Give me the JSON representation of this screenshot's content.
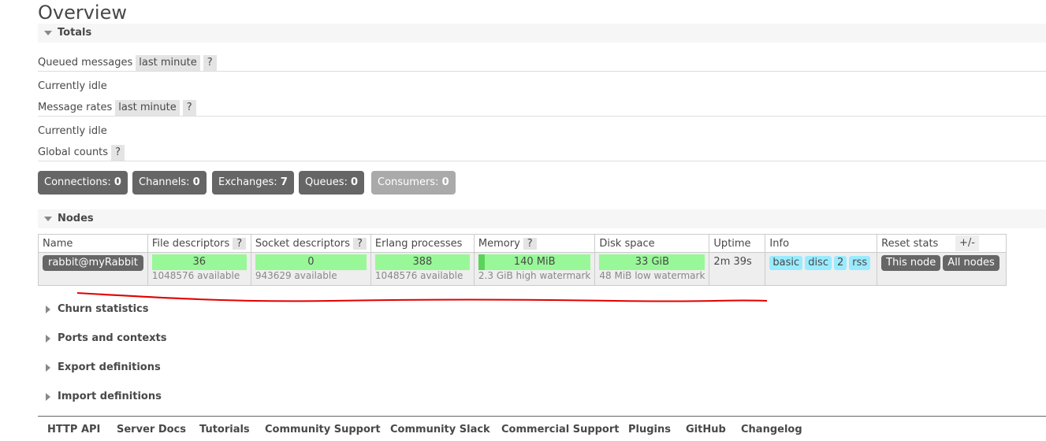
{
  "page": {
    "title": "Overview"
  },
  "totals": {
    "header": "Totals",
    "queued_label": "Queued messages",
    "queued_range": "last minute",
    "help": "?",
    "queued_status": "Currently idle",
    "rates_label": "Message rates",
    "rates_range": "last minute",
    "rates_status": "Currently idle",
    "global_label": "Global counts"
  },
  "counts": [
    {
      "label": "Connections:",
      "value": "0"
    },
    {
      "label": "Channels:",
      "value": "0"
    },
    {
      "label": "Exchanges:",
      "value": "7"
    },
    {
      "label": "Queues:",
      "value": "0"
    },
    {
      "label": "Consumers:",
      "value": "0"
    }
  ],
  "nodes": {
    "header": "Nodes",
    "columns": {
      "name": "Name",
      "file_descriptors": "File descriptors",
      "socket_descriptors": "Socket descriptors",
      "erlang_processes": "Erlang processes",
      "memory": "Memory",
      "disk_space": "Disk space",
      "uptime": "Uptime",
      "info": "Info",
      "reset_stats": "Reset stats"
    },
    "plus_minus": "+/-",
    "row": {
      "name": "rabbit@myRabbit",
      "file_descriptors": "36",
      "file_available": "1048576 available",
      "socket_descriptors": "0",
      "socket_available": "943629 available",
      "erlang_processes": "388",
      "erlang_available": "1048576 available",
      "memory": "140 MiB",
      "memory_watermark": "2.3 GiB high watermark",
      "memory_fraction": 0.06,
      "disk_space": "33 GiB",
      "disk_watermark": "48 MiB low watermark",
      "uptime": "2m 39s",
      "info": [
        "basic",
        "disc",
        "2",
        "rss"
      ],
      "reset_this": "This node",
      "reset_all": "All nodes"
    }
  },
  "collapsed_sections": [
    "Churn statistics",
    "Ports and contexts",
    "Export definitions",
    "Import definitions"
  ],
  "footer_links": [
    "HTTP API",
    "Server Docs",
    "Tutorials",
    "Community Support",
    "Community Slack",
    "Commercial Support",
    "Plugins",
    "GitHub",
    "Changelog"
  ],
  "colors": {
    "bar_green": "#98f898",
    "info_blue": "#99ebff",
    "annotation_red": "#e00000"
  }
}
